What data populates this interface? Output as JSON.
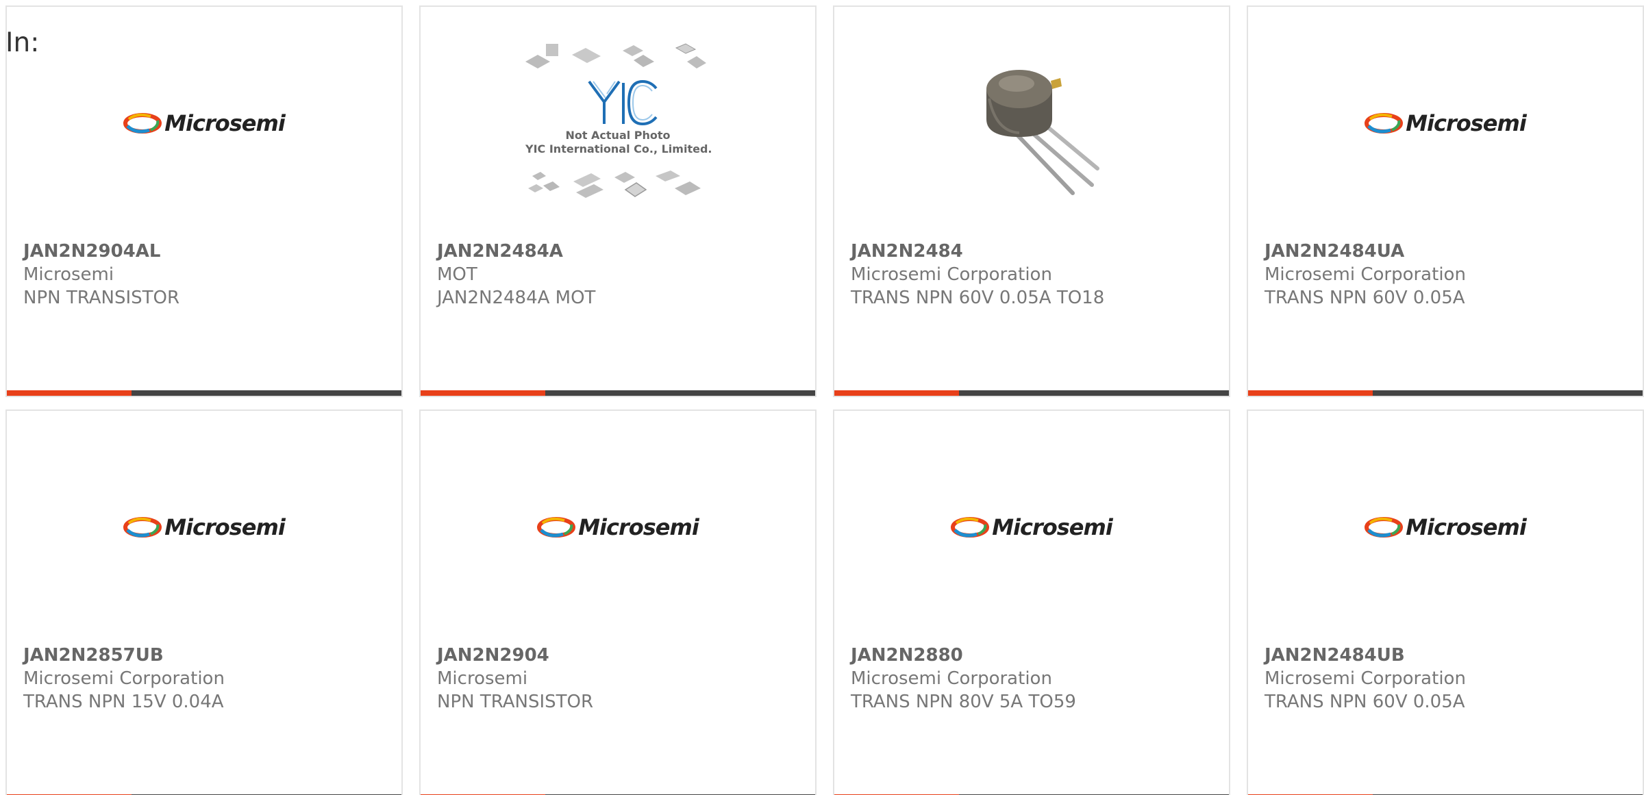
{
  "prefix_label": "In:",
  "colors": {
    "accent": "#e8401a",
    "bar": "#444444",
    "border": "#e3e3e3",
    "text": "#777777"
  },
  "logo_text": "Microsemi",
  "placeholder": {
    "line1": "Not Actual Photo",
    "line2": "YIC International Co., Limited."
  },
  "products": [
    {
      "part": "JAN2N2904AL",
      "manufacturer": "Microsemi",
      "description": "NPN TRANSISTOR",
      "image": "microsemi-logo"
    },
    {
      "part": "JAN2N2484A",
      "manufacturer": "MOT",
      "description": "JAN2N2484A MOT",
      "image": "yic-placeholder"
    },
    {
      "part": "JAN2N2484",
      "manufacturer": "Microsemi Corporation",
      "description": "TRANS NPN 60V 0.05A TO18",
      "image": "transistor-photo"
    },
    {
      "part": "JAN2N2484UA",
      "manufacturer": "Microsemi Corporation",
      "description": "TRANS NPN 60V 0.05A",
      "image": "microsemi-logo"
    },
    {
      "part": "JAN2N2857UB",
      "manufacturer": "Microsemi Corporation",
      "description": "TRANS NPN 15V 0.04A",
      "image": "microsemi-logo"
    },
    {
      "part": "JAN2N2904",
      "manufacturer": "Microsemi",
      "description": "NPN TRANSISTOR",
      "image": "microsemi-logo"
    },
    {
      "part": "JAN2N2880",
      "manufacturer": "Microsemi Corporation",
      "description": "TRANS NPN 80V 5A TO59",
      "image": "microsemi-logo"
    },
    {
      "part": "JAN2N2484UB",
      "manufacturer": "Microsemi Corporation",
      "description": "TRANS NPN 60V 0.05A",
      "image": "microsemi-logo"
    }
  ]
}
